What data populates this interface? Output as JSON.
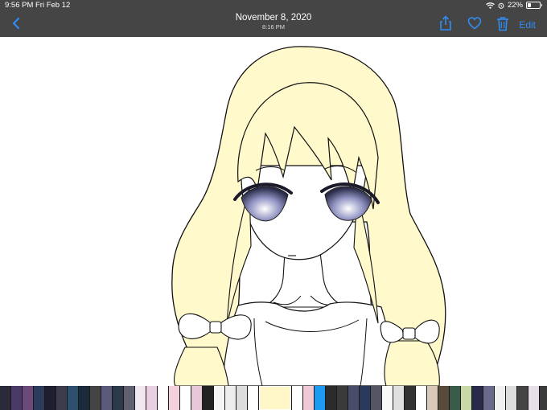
{
  "status": {
    "time": "9:56 PM",
    "date": "Fri Feb 12",
    "battery": "22%",
    "battery_level": 0.22
  },
  "header": {
    "title": "November 8, 2020",
    "subtitle": "8:16 PM",
    "edit_label": "Edit"
  },
  "icons": {
    "back": "chevron-left-icon",
    "share": "share-icon",
    "favorite": "heart-icon",
    "delete": "trash-icon"
  },
  "colors": {
    "accent": "#2f8cf2",
    "bar": "#454545",
    "hair": "#fff9cc"
  },
  "thumbnails": [
    {
      "color": "#2a2a3a"
    },
    {
      "color": "#4a3a6a"
    },
    {
      "color": "#6b4a7a"
    },
    {
      "color": "#2b3b5b"
    },
    {
      "color": "#1e1e2e"
    },
    {
      "color": "#3c3c4c"
    },
    {
      "color": "#2f4f6f"
    },
    {
      "color": "#1b2b3b"
    },
    {
      "color": "#444444"
    },
    {
      "color": "#5a5a7a"
    },
    {
      "color": "#2a3a4a"
    },
    {
      "color": "#606070"
    },
    {
      "color": "#f0e8ee"
    },
    {
      "color": "#e8d0e0"
    },
    {
      "color": "#ffffff"
    },
    {
      "color": "#f4d0dc"
    },
    {
      "color": "#ffffff"
    },
    {
      "color": "#e6c8d8"
    },
    {
      "color": "#222222"
    },
    {
      "color": "#f5f5f5"
    },
    {
      "color": "#eeeeee"
    },
    {
      "color": "#dddddd"
    },
    {
      "color": "#ffffff"
    },
    {
      "color": "#fff7c8"
    },
    {
      "color": "#ffffff"
    },
    {
      "color": "#f2c8d4"
    },
    {
      "color": "#1d9bf0"
    },
    {
      "color": "#2b2b2b"
    },
    {
      "color": "#3a3a3a"
    },
    {
      "color": "#4b4b6b"
    },
    {
      "color": "#2a3a5a"
    },
    {
      "color": "#555566"
    },
    {
      "color": "#f8f8f8"
    },
    {
      "color": "#e0e0e0"
    },
    {
      "color": "#333333"
    },
    {
      "color": "#ffffff"
    },
    {
      "color": "#d8c8b8"
    },
    {
      "color": "#5a4a3a"
    },
    {
      "color": "#3a5a4a"
    },
    {
      "color": "#c8d8a8"
    },
    {
      "color": "#2a2a4a"
    },
    {
      "color": "#6a6a8a"
    },
    {
      "color": "#f0f0f0"
    },
    {
      "color": "#dcdcdc"
    },
    {
      "color": "#444444"
    },
    {
      "color": "#e8e0e8"
    },
    {
      "color": "#3b3b3b"
    },
    {
      "color": "#ffffff"
    }
  ]
}
